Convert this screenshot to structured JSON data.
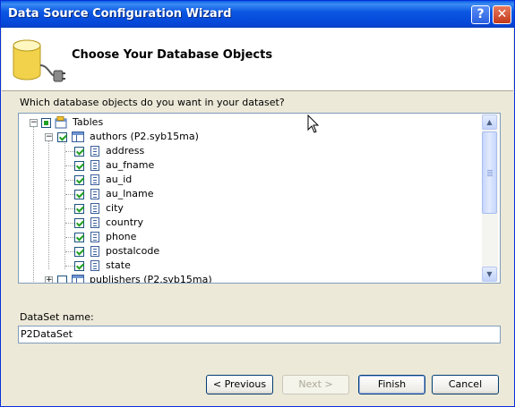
{
  "window": {
    "title": "Data Source Configuration Wizard",
    "help_glyph": "?",
    "close_glyph": "✕"
  },
  "header": {
    "title": "Choose Your Database Objects"
  },
  "question": "Which database objects do you want in your dataset?",
  "tree": {
    "root": {
      "label": "Tables",
      "expander": "−",
      "state": "partial"
    },
    "table": {
      "label": "authors (P2.syb15ma)",
      "expander": "−",
      "state": "checked"
    },
    "columns": [
      {
        "label": "address",
        "state": "checked"
      },
      {
        "label": "au_fname",
        "state": "checked"
      },
      {
        "label": "au_id",
        "state": "checked"
      },
      {
        "label": "au_lname",
        "state": "checked"
      },
      {
        "label": "city",
        "state": "checked"
      },
      {
        "label": "country",
        "state": "checked"
      },
      {
        "label": "phone",
        "state": "checked"
      },
      {
        "label": "postalcode",
        "state": "checked"
      },
      {
        "label": "state",
        "state": "checked"
      }
    ],
    "next_table": {
      "label": "publishers (P2.syb15ma)",
      "expander": "+",
      "state": "unchecked"
    }
  },
  "scrollbar": {
    "up_glyph": "▲",
    "down_glyph": "▼"
  },
  "dataset": {
    "label": "DataSet name:",
    "value": "P2DataSet"
  },
  "buttons": {
    "previous": "< Previous",
    "next": "Next >",
    "finish": "Finish",
    "cancel": "Cancel"
  },
  "colors": {
    "titlebar": "#0a5fe8",
    "dialog_bg": "#ece9d8",
    "check_green": "#21a121"
  }
}
